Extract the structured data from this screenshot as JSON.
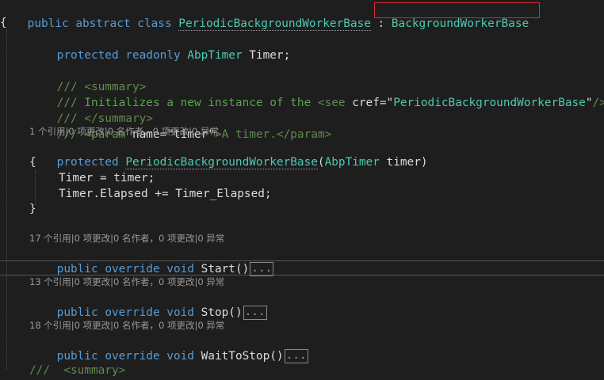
{
  "code": {
    "class_decl": {
      "kw_public": "public",
      "kw_abstract": "abstract",
      "kw_class": "class",
      "class_name": "PeriodicBackgroundWorkerBase",
      "colon": " : ",
      "base_class": "BackgroundWorkerBase"
    },
    "open_brace": "{",
    "timer_field": {
      "kw_protected": "protected",
      "kw_readonly": "readonly",
      "type": "AbpTimer",
      "name": "Timer;"
    },
    "doc": {
      "line1_slashes": "///",
      "line1_tag": " <summary>",
      "line2_slashes": "///",
      "line2_text": " Initializes a new instance of the ",
      "line2_see": "<see",
      "line2_attr": " cref=",
      "line2_q1": "\"",
      "line2_ref": "PeriodicBackgroundWorkerBase",
      "line2_q2": "\"",
      "line2_close": "/>",
      "line3_slashes": "///",
      "line3_tag": " </summary>",
      "line4_slashes": "///",
      "line4_open": " <param",
      "line4_attr": " name=",
      "line4_q1": "\"",
      "line4_value": "timer",
      "line4_q2": "\"",
      "line4_rest": ">A timer.</param>"
    },
    "codelens": {
      "ctor": "1 个引用|0 项更改|0 名作者，0 项更改|0 异常",
      "start": "17 个引用|0 项更改|0 名作者，0 项更改|0 异常",
      "stop": "13 个引用|0 项更改|0 名作者，0 项更改|0 异常",
      "wait": "18 个引用|0 项更改|0 名作者，0 项更改|0 异常"
    },
    "ctor": {
      "kw_protected": "protected",
      "name": "PeriodicBackgroundWorkerBase",
      "paren_open": "(",
      "param_type": "AbpTimer",
      "param_name": " timer)",
      "open_brace": "{",
      "body1": "Timer = timer;",
      "body2": "Timer.Elapsed += Timer_Elapsed;",
      "close_brace": "}"
    },
    "start": {
      "kw_public": "public",
      "kw_override": "override",
      "kw_void": "void",
      "name": "Start()",
      "collapsed": "..."
    },
    "stop": {
      "kw_public": "public",
      "kw_override": "override",
      "kw_void": "void",
      "name": "Stop()",
      "collapsed": "..."
    },
    "wait": {
      "kw_public": "public",
      "kw_override": "override",
      "kw_void": "void",
      "name": "WaitToStop()",
      "collapsed": "..."
    },
    "partial_last": "///  <summary>"
  },
  "colors": {
    "background": "#1e1e1e",
    "keyword": "#569cd6",
    "type": "#4ec9b0",
    "comment": "#57a64a",
    "highlight": "#e0282a"
  }
}
